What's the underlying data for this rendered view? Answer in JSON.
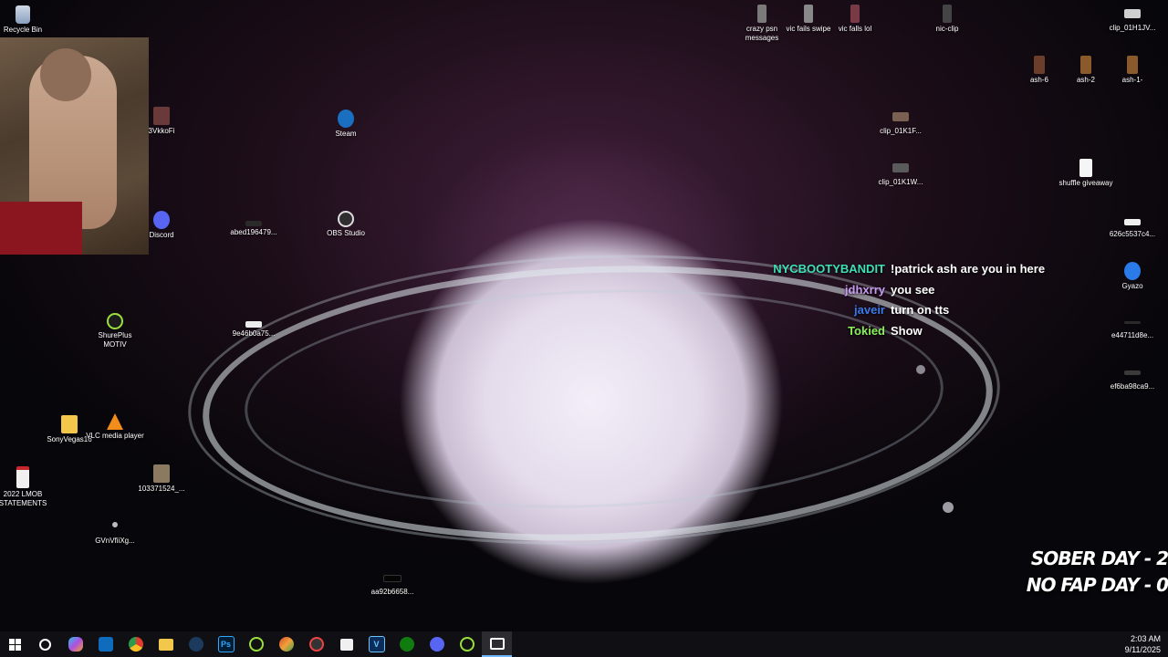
{
  "desktop_icons": [
    {
      "label": "Recycle Bin",
      "icon": "recycle-bin-icon"
    },
    {
      "label": "Steam",
      "icon": "steam-icon"
    },
    {
      "label": "Discord",
      "icon": "discord-icon"
    },
    {
      "label": "abed196479...",
      "icon": "image-file-icon"
    },
    {
      "label": "OBS Studio",
      "icon": "obs-icon"
    },
    {
      "label": "ShurePlus MOTIV",
      "icon": "shureplus-icon"
    },
    {
      "label": "9e46b0a75...",
      "icon": "image-file-icon"
    },
    {
      "label": "SonyVegas16",
      "icon": "folder-icon"
    },
    {
      "label": "VLC media player",
      "icon": "vlc-icon"
    },
    {
      "label": "2022 LMOB STATEMENTS",
      "icon": "pdf-icon"
    },
    {
      "label": "103371524_...",
      "icon": "image-file-icon"
    },
    {
      "label": "GVnVfiiXg...",
      "icon": "image-file-icon"
    },
    {
      "label": "aa92b6658...",
      "icon": "image-file-icon"
    },
    {
      "label": "3VkkoFi",
      "icon": "video-file-icon"
    },
    {
      "label": "crazy psn messages",
      "icon": "video-file-icon"
    },
    {
      "label": "vic fails swipe",
      "icon": "video-file-icon"
    },
    {
      "label": "vic falls lol",
      "icon": "video-file-icon"
    },
    {
      "label": "nic-clip",
      "icon": "video-file-icon"
    },
    {
      "label": "clip_01H1JV...",
      "icon": "video-file-icon"
    },
    {
      "label": "ash-6",
      "icon": "video-file-icon"
    },
    {
      "label": "ash-2",
      "icon": "video-file-icon"
    },
    {
      "label": "ash-1-",
      "icon": "video-file-icon"
    },
    {
      "label": "clip_01K1F...",
      "icon": "video-file-icon"
    },
    {
      "label": "clip_01K1W...",
      "icon": "video-file-icon"
    },
    {
      "label": "shuffle giveaway",
      "icon": "text-file-icon"
    },
    {
      "label": "626c5537c4...",
      "icon": "image-file-icon"
    },
    {
      "label": "Gyazo",
      "icon": "gyazo-icon"
    },
    {
      "label": "e44711d8e...",
      "icon": "image-file-icon"
    },
    {
      "label": "ef6ba98ca9...",
      "icon": "image-file-icon"
    }
  ],
  "chat": [
    {
      "user": "NYCBOOTYBANDIT",
      "color": "#3fe0b4",
      "message": "!patrick ash are you in here"
    },
    {
      "user": "jdhxrry",
      "color": "#c89cf2",
      "message": "you see"
    },
    {
      "user": "javeir",
      "color": "#3a7ae8",
      "message": "turn on tts"
    },
    {
      "user": "Tokied",
      "color": "#8af05a",
      "message": "Show"
    }
  ],
  "counters": {
    "sober": "SOBER DAY - 2",
    "nofap": "NO FAP DAY - 0"
  },
  "taskbar": {
    "items": [
      "start-icon",
      "search-icon",
      "copilot-icon",
      "outlook-icon",
      "chrome-icon",
      "file-explorer-icon",
      "steam-icon",
      "photoshop-icon",
      "shureplus-icon",
      "app-icon",
      "app-icon",
      "store-icon",
      "v-app-icon",
      "xbox-icon",
      "discord-icon",
      "shureplus-icon",
      "active-app-icon"
    ],
    "ps_label": "Ps",
    "v_label": "V"
  },
  "clock": {
    "time": "2:03 AM",
    "date": "9/11/2025"
  }
}
